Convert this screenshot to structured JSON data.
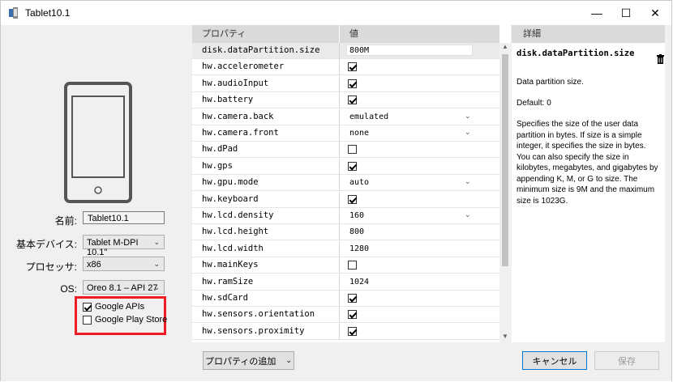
{
  "window": {
    "title": "Tablet10.1",
    "minimize": "—",
    "maximize": "☐",
    "close": "✕"
  },
  "form": {
    "name_label": "名前:",
    "name_value": "Tablet10.1",
    "device_label": "基本デバイス:",
    "device_value": "Tablet M-DPI 10.1\"",
    "processor_label": "プロセッサ:",
    "processor_value": "x86",
    "os_label": "OS:",
    "os_value": "Oreo 8.1 – API 27",
    "google_apis": {
      "label": "Google APIs",
      "checked": true
    },
    "google_play": {
      "label": "Google Play Store",
      "checked": false
    }
  },
  "grid": {
    "col_property": "プロパティ",
    "col_value": "値",
    "rows": [
      {
        "name": "disk.dataPartition.size",
        "type": "text",
        "value": "800M",
        "selected": true
      },
      {
        "name": "hw.accelerometer",
        "type": "check",
        "checked": true
      },
      {
        "name": "hw.audioInput",
        "type": "check",
        "checked": true
      },
      {
        "name": "hw.battery",
        "type": "check",
        "checked": true
      },
      {
        "name": "hw.camera.back",
        "type": "select",
        "value": "emulated"
      },
      {
        "name": "hw.camera.front",
        "type": "select",
        "value": "none"
      },
      {
        "name": "hw.dPad",
        "type": "check",
        "checked": false
      },
      {
        "name": "hw.gps",
        "type": "check",
        "checked": true
      },
      {
        "name": "hw.gpu.mode",
        "type": "select",
        "value": "auto"
      },
      {
        "name": "hw.keyboard",
        "type": "check",
        "checked": true
      },
      {
        "name": "hw.lcd.density",
        "type": "select",
        "value": "160"
      },
      {
        "name": "hw.lcd.height",
        "type": "text",
        "value": "800"
      },
      {
        "name": "hw.lcd.width",
        "type": "text",
        "value": "1280"
      },
      {
        "name": "hw.mainKeys",
        "type": "check",
        "checked": false
      },
      {
        "name": "hw.ramSize",
        "type": "text",
        "value": "1024"
      },
      {
        "name": "hw.sdCard",
        "type": "check",
        "checked": true
      },
      {
        "name": "hw.sensors.orientation",
        "type": "check",
        "checked": true
      },
      {
        "name": "hw.sensors.proximity",
        "type": "check",
        "checked": true
      }
    ]
  },
  "detail": {
    "header": "詳細",
    "title": "disk.dataPartition.size",
    "line1": "Data partition size.",
    "line2": "Default: 0",
    "line3": "Specifies the size of the user data partition in bytes. If size is a simple integer, it specifies the size in bytes. You can also specify the size in kilobytes, megabytes, and gigabytes by appending K, M, or G to size. The minimum size is 9M and the maximum size is 1023G."
  },
  "buttons": {
    "add_property": "プロパティの追加",
    "cancel": "キャンセル",
    "save": "保存"
  }
}
